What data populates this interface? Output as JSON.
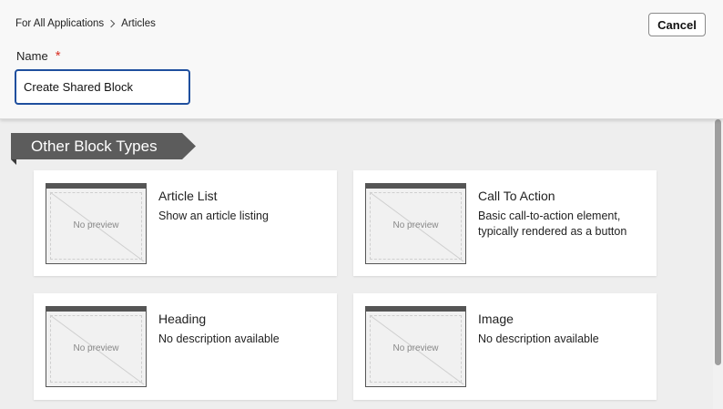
{
  "breadcrumb": {
    "root": "For All Applications",
    "current": "Articles"
  },
  "actions": {
    "cancel_label": "Cancel"
  },
  "form": {
    "name_label": "Name",
    "required_mark": "*",
    "name_value": "Create Shared Block"
  },
  "section": {
    "title": "Other Block Types"
  },
  "cards": [
    {
      "title": "Article List",
      "description": "Show an article listing",
      "preview": "No preview"
    },
    {
      "title": "Call To Action",
      "description": "Basic call-to-action element, typically rendered as a button",
      "preview": "No preview"
    },
    {
      "title": "Heading",
      "description": "No description available",
      "preview": "No preview"
    },
    {
      "title": "Image",
      "description": "No description available",
      "preview": "No preview"
    }
  ],
  "colors": {
    "accent": "#1f4f9e",
    "required": "#d93025",
    "banner": "#5c5c5c"
  }
}
